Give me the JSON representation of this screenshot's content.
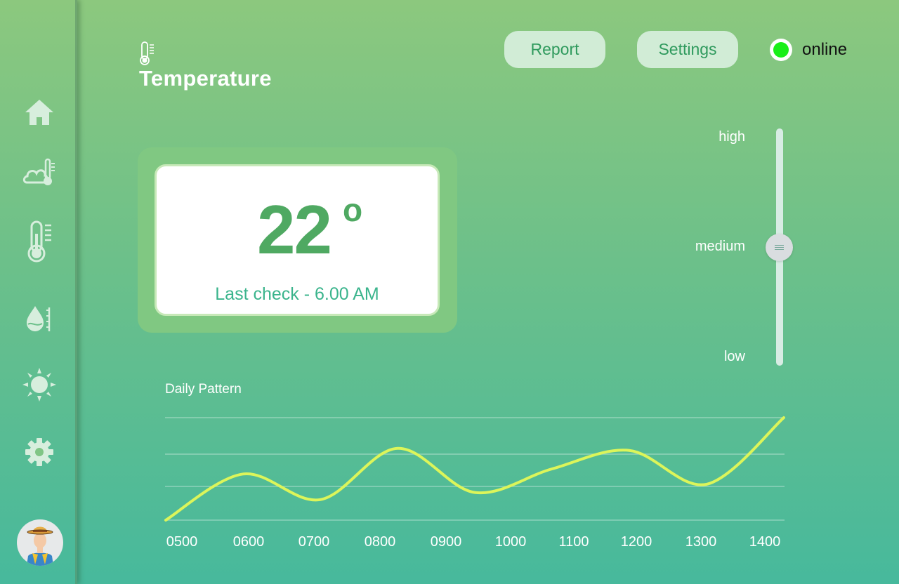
{
  "header": {
    "title": "Temperature",
    "report_label": "Report",
    "settings_label": "Settings",
    "status": "online"
  },
  "sidebar": {
    "items": [
      {
        "icon": "home-icon"
      },
      {
        "icon": "weather-icon"
      },
      {
        "icon": "thermometer-icon"
      },
      {
        "icon": "humidity-icon"
      },
      {
        "icon": "sun-icon"
      },
      {
        "icon": "gear-icon"
      }
    ]
  },
  "temperature_card": {
    "value": "22",
    "unit": "o",
    "last_check": "Last check - 6.00 AM"
  },
  "level_slider": {
    "high": "high",
    "medium": "medium",
    "low": "low",
    "current": "medium"
  },
  "colors": {
    "accent": "#4fa962",
    "line": "#dcf55a",
    "status": "#18ef18"
  },
  "chart_data": {
    "type": "line",
    "title": "Daily Pattern",
    "categories": [
      "0500",
      "0600",
      "0700",
      "0800",
      "0900",
      "1000",
      "1100",
      "1200",
      "1300",
      "1400"
    ],
    "values": [
      0,
      0.45,
      0.2,
      0.7,
      0.27,
      0.5,
      0.68,
      0.35,
      1.0
    ]
  }
}
